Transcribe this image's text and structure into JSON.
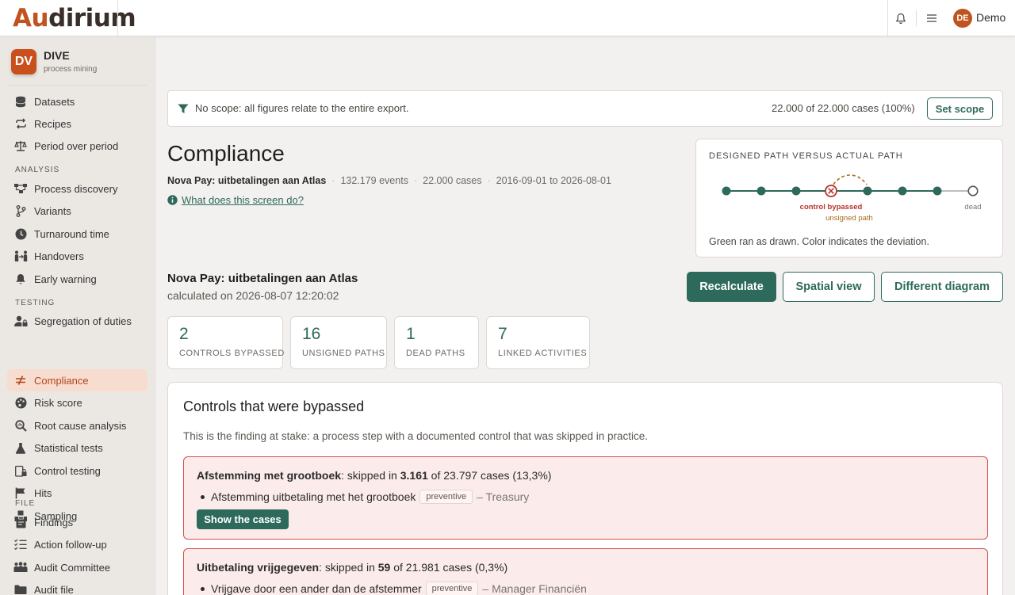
{
  "app": {
    "logo_first": "Au",
    "logo_rest": "dirium",
    "user_initials": "DE",
    "user_name": "Demo"
  },
  "workspace": {
    "badge": "DV",
    "name": "DIVE",
    "subtitle": "process mining"
  },
  "sidebar": {
    "top_items": [
      {
        "label": "Datasets",
        "icon": "database-icon"
      },
      {
        "label": "Recipes",
        "icon": "repeat-icon"
      },
      {
        "label": "Period over period",
        "icon": "scale-icon"
      }
    ],
    "analysis_label": "ANALYSIS",
    "analysis_items": [
      {
        "label": "Process discovery",
        "icon": "process-icon"
      },
      {
        "label": "Variants",
        "icon": "branch-icon"
      },
      {
        "label": "Turnaround time",
        "icon": "clock-icon"
      },
      {
        "label": "Handovers",
        "icon": "handover-icon"
      },
      {
        "label": "Early warning",
        "icon": "bell-icon"
      }
    ],
    "testing_label": "TESTING",
    "testing_items": [
      {
        "label": "Segregation of duties",
        "icon": "user-lock-icon"
      },
      {
        "label": "Compliance",
        "icon": "not-equal-icon",
        "active": true
      },
      {
        "label": "Risk score",
        "icon": "palette-icon"
      },
      {
        "label": "Root cause analysis",
        "icon": "magnifier-icon"
      },
      {
        "label": "Statistical tests",
        "icon": "flask-icon"
      },
      {
        "label": "Control testing",
        "icon": "clipboard-lock-icon"
      },
      {
        "label": "Hits",
        "icon": "flag-icon"
      },
      {
        "label": "Sampling",
        "icon": "cubes-icon"
      }
    ],
    "file_label": "FILE",
    "file_items": [
      {
        "label": "Findings",
        "icon": "clipboard-icon"
      },
      {
        "label": "Action follow-up",
        "icon": "checklist-icon"
      },
      {
        "label": "Audit Committee",
        "icon": "people-icon"
      },
      {
        "label": "Audit file",
        "icon": "folder-icon"
      }
    ]
  },
  "scope": {
    "text": "No scope: all figures relate to the entire export.",
    "count": "22.000 of 22.000 cases (100%)",
    "button": "Set scope"
  },
  "page": {
    "title": "Compliance",
    "dataset": "Nova Pay: uitbetalingen aan Atlas",
    "events": "132.179 events",
    "cases": "22.000 cases",
    "period": "2016-09-01 to 2026-08-01",
    "help": "What does this screen do?"
  },
  "diagram": {
    "title": "DESIGNED PATH VERSUS ACTUAL PATH",
    "label_bypassed": "control bypassed",
    "label_unsigned": "unsigned path",
    "label_dead": "dead",
    "caption": "Green ran as drawn. Color indicates the deviation.",
    "colors": {
      "ok": "#2d6a5b",
      "bypassed": "#b8322b",
      "unsigned": "#a86b1f",
      "dead": "#777777"
    }
  },
  "calc": {
    "title": "Nova Pay: uitbetalingen aan Atlas",
    "subtitle": "calculated on 2026-08-07 12:20:02",
    "btn_recalc": "Recalculate",
    "btn_spatial": "Spatial view",
    "btn_diagram": "Different diagram"
  },
  "stats": [
    {
      "value": "2",
      "label": "CONTROLS BYPASSED"
    },
    {
      "value": "16",
      "label": "UNSIGNED PATHS"
    },
    {
      "value": "1",
      "label": "DEAD PATHS"
    },
    {
      "value": "7",
      "label": "LINKED ACTIVITIES"
    }
  ],
  "bypassed": {
    "title": "Controls that were bypassed",
    "subtitle": "This is the finding at stake: a process step with a documented control that was skipped in practice.",
    "findings": [
      {
        "step": "Afstemming met grootboek",
        "skipped_prefix": ": skipped in ",
        "skipped": "3.161",
        "of_text": " of 23.797 cases (13,3%)",
        "control": "Afstemming uitbetaling met het grootboek",
        "type": "preventive",
        "owner": "– Treasury",
        "button": "Show the cases"
      },
      {
        "step": "Uitbetaling vrijgegeven",
        "skipped_prefix": ": skipped in ",
        "skipped": "59",
        "of_text": " of 21.981 cases (0,3%)",
        "control": "Vrijgave door een ander dan de afstemmer",
        "type": "preventive",
        "owner": "– Manager Financiën"
      }
    ]
  },
  "accent": "#2d6a5b",
  "brand": "#c0531f"
}
